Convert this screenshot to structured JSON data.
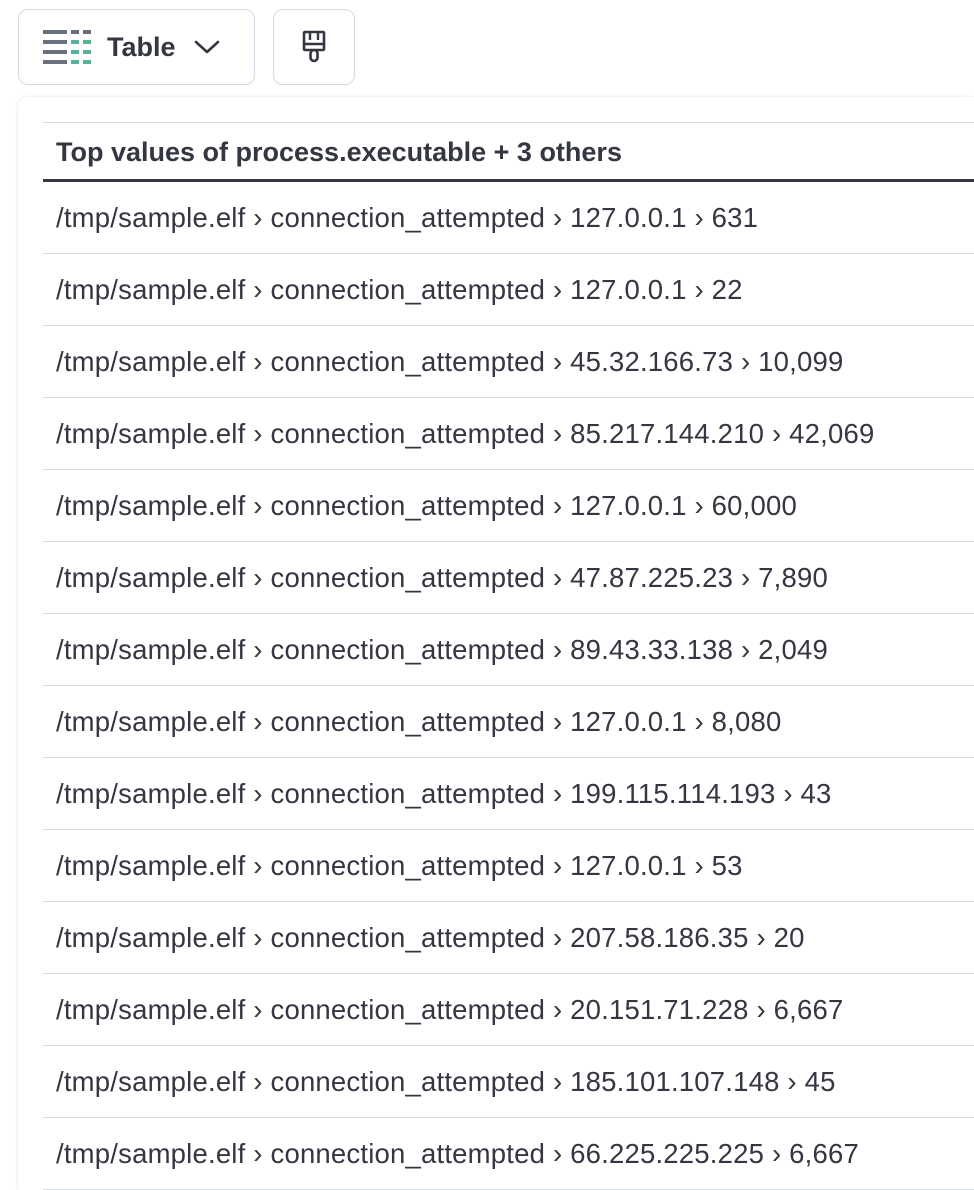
{
  "toolbar": {
    "visualization_label": "Table",
    "visualization_icon": "table-icon",
    "chevron_icon": "chevron-down-icon",
    "brush_icon": "paintbrush-icon"
  },
  "colors": {
    "text": "#343741",
    "border": "#d3dae6",
    "icon_gray": "#69707d",
    "icon_green": "#54b399"
  },
  "table": {
    "header": "Top values of process.executable + 3 others",
    "rows": [
      "/tmp/sample.elf › connection_attempted › 127.0.0.1 › 631",
      "/tmp/sample.elf › connection_attempted › 127.0.0.1 › 22",
      "/tmp/sample.elf › connection_attempted › 45.32.166.73 › 10,099",
      "/tmp/sample.elf › connection_attempted › 85.217.144.210 › 42,069",
      "/tmp/sample.elf › connection_attempted › 127.0.0.1 › 60,000",
      "/tmp/sample.elf › connection_attempted › 47.87.225.23 › 7,890",
      "/tmp/sample.elf › connection_attempted › 89.43.33.138 › 2,049",
      "/tmp/sample.elf › connection_attempted › 127.0.0.1 › 8,080",
      "/tmp/sample.elf › connection_attempted › 199.115.114.193 › 43",
      "/tmp/sample.elf › connection_attempted › 127.0.0.1 › 53",
      "/tmp/sample.elf › connection_attempted › 207.58.186.35 › 20",
      "/tmp/sample.elf › connection_attempted › 20.151.71.228 › 6,667",
      "/tmp/sample.elf › connection_attempted › 185.101.107.148 › 45",
      "/tmp/sample.elf › connection_attempted › 66.225.225.225 › 6,667"
    ]
  }
}
